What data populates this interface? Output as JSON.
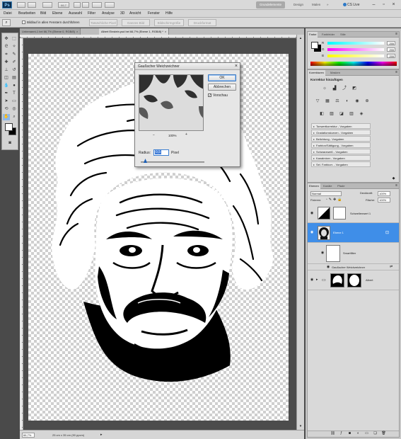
{
  "titlebar": {
    "app_logo": "Ps",
    "zoom_level": "66,7",
    "workspaces": [
      "Grundelemente",
      "Design",
      "Malen"
    ],
    "cs_live": "CS Live"
  },
  "menu": [
    "Datei",
    "Bearbeiten",
    "Bild",
    "Ebene",
    "Auswahl",
    "Filter",
    "Analyse",
    "3D",
    "Ansicht",
    "Fenster",
    "Hilfe"
  ],
  "options": {
    "checkbox_label": "Bildlauf in allen Fenstern durchführen",
    "buttons": [
      "Tatsächliche Pixel",
      "Ganzes Bild",
      "Bildschirmgröße",
      "Druckformat"
    ]
  },
  "document": {
    "tabs": [
      {
        "label": "Unbenannt-1 bei 66,7% (Ebene 0, RGB/8)",
        "active": false
      },
      {
        "label": "Albert Einstein.psd bei 66,7% (Ebene 1, RGB/8) *",
        "active": true
      }
    ],
    "zoom": "66,7%",
    "status": "25 cm x 35 cm (90 ppcm)"
  },
  "dialog": {
    "title": "Gaußscher Weichzeichner",
    "ok": "OK",
    "cancel": "Abbrechen",
    "preview_label": "Vorschau",
    "preview_checked": true,
    "zoom_minus": "−",
    "zoom_value": "100%",
    "zoom_plus": "+",
    "radius_label": "Radius:",
    "radius_value": "0,5",
    "radius_unit": "Pixel"
  },
  "color_panel": {
    "tabs": [
      "Farbe",
      "Farbfelder",
      "Stile"
    ],
    "channels": [
      {
        "label": "R",
        "value": "255",
        "gradient": "linear-gradient(90deg,#00ffff,#ffffff)"
      },
      {
        "label": "G",
        "value": "255",
        "gradient": "linear-gradient(90deg,#ff00ff,#ffffff)"
      },
      {
        "label": "B",
        "value": "255",
        "gradient": "linear-gradient(90deg,#ffff00,#ffffff)"
      }
    ]
  },
  "adjust_panel": {
    "tabs": [
      "Korrekturen",
      "Masken"
    ],
    "title": "Korrektur hinzufügen",
    "presets": [
      "Tonwertkorrektur - Vorgaben",
      "Gradationskurven - Vorgaben",
      "Belichtung - Vorgaben",
      "Farbton/Sättigung - Vorgaben",
      "Schwarzweiß - Vorgaben",
      "Kanalmixer - Vorgaben",
      "Sel. Farbkorr. - Vorgaben"
    ]
  },
  "layers_panel": {
    "tabs": [
      "Ebenen",
      "Kanäle",
      "Pfade"
    ],
    "blend_mode": "Normal",
    "opacity_label": "Deckkraft:",
    "opacity_value": "100%",
    "lock_label": "Fixieren:",
    "fill_label": "Fläche:",
    "fill_value": "100%",
    "layers": [
      {
        "name": "Schwellenwert 1",
        "selected": false
      },
      {
        "name": "Ebene 1",
        "selected": true
      },
      {
        "name": "Smartfilter",
        "selected": false
      },
      {
        "name": "Gaußscher Weichzeichner",
        "selected": false
      },
      {
        "name": "Albert",
        "selected": false
      }
    ]
  }
}
